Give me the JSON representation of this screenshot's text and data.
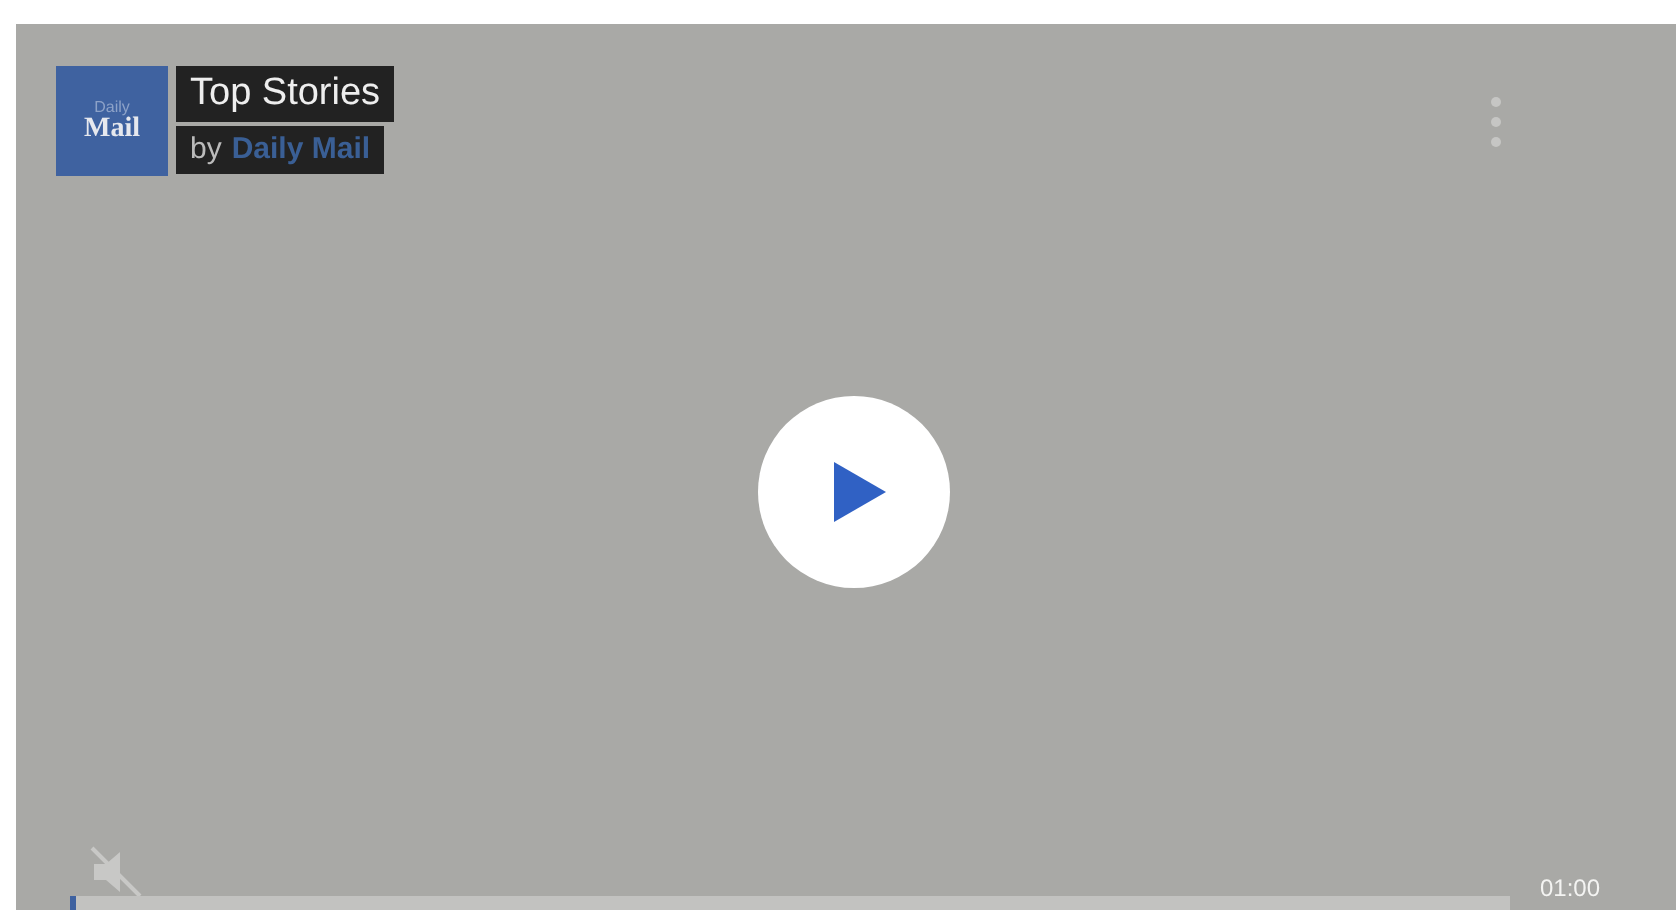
{
  "player": {
    "logo": {
      "line_1": "Daily",
      "line_2": "Mail"
    },
    "title": "Top Stories",
    "byline": {
      "prefix": "by",
      "source": "Daily Mail"
    },
    "muted": true,
    "time": "01:00"
  }
}
